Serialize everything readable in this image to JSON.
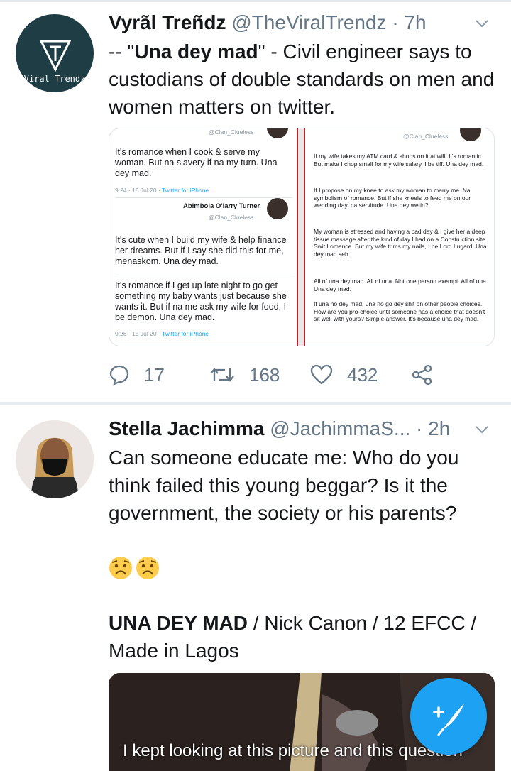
{
  "tweet1": {
    "avatar_text": "Viral Trendz",
    "name": "Vyrãl Treñdz",
    "handle": "@TheViralTrendz",
    "separator": "·",
    "time": "7h",
    "text_prefix": "-- \"",
    "text_bold": "Una dey mad",
    "text_rest": "\" - Civil engineer says to custodians of  double standards  on men and women matters on twitter.",
    "image_left": {
      "handle_top": "@Clan_Clueless",
      "tweet_a": "It's romance when I cook & serve my woman. But na slavery if na my turn. Una dey mad.",
      "meta_a_time": "9:24 · 15 Jul 20 ·",
      "meta_a_link": "Twitter for iPhone",
      "reply_name": "Abimbola O'larry Turner",
      "reply_handle": "@Clan_Clueless",
      "tweet_b": "It's cute when I build my wife & help finance her dreams. But if I say she did this for me, menaskom. Una dey mad.",
      "tweet_c": "It's romance if I get up late night to go get something my baby wants just because she wants it. But if na me ask my wife for food, I be demon. Una dey mad.",
      "meta_c_time": "9:26 · 15 Jul 20 ·",
      "meta_c_link": "Twitter for iPhone"
    },
    "image_right": {
      "handle_top": "@Clan_Clueless",
      "para1": "If my wife takes my ATM card & shops on it at will. It's romantic. But make I chop small for my wife salary, I be tiff. Una dey mad.",
      "para2": "If I propose on my knee to ask my woman to marry me. Na symbolism of romance. But if she kneels to feed me on our wedding day, na servitude. Una dey wetin?",
      "para3": "My woman is stressed and having a bad day & I give her a deep tissue massage after the kind of day I had on a Construction site. Swit Lomance. But my wife trims my nails, I be Lord Lugard. Una dey mad seh.",
      "para4": "All of una dey mad. All of una. Not one person exempt. All of una. Una dey mad.",
      "para5": "If una no dey mad, una no go dey shit on other people choices. How are you pro-choice until someone has a choice that doesn't sit well with yours? Simple answer. It's because una dey mad."
    },
    "replies": "17",
    "retweets": "168",
    "likes": "432"
  },
  "tweet2": {
    "name": "Stella Jachimma",
    "handle": "@JachimmaS...",
    "separator": "·",
    "time": "2h",
    "text": "Can someone educate me: Who do you think failed this young beggar? Is it the government, the society or his parents?",
    "song_bold": "UNA DEY MAD",
    "song_rest": " / Nick Canon / 12 EFCC / Made in Lagos",
    "video_caption": "I kept looking at this picture and this question"
  },
  "fab": {
    "icon": "compose-icon"
  },
  "colors": {
    "accent": "#1da1f2",
    "muted": "#657786",
    "text": "#14171a"
  }
}
